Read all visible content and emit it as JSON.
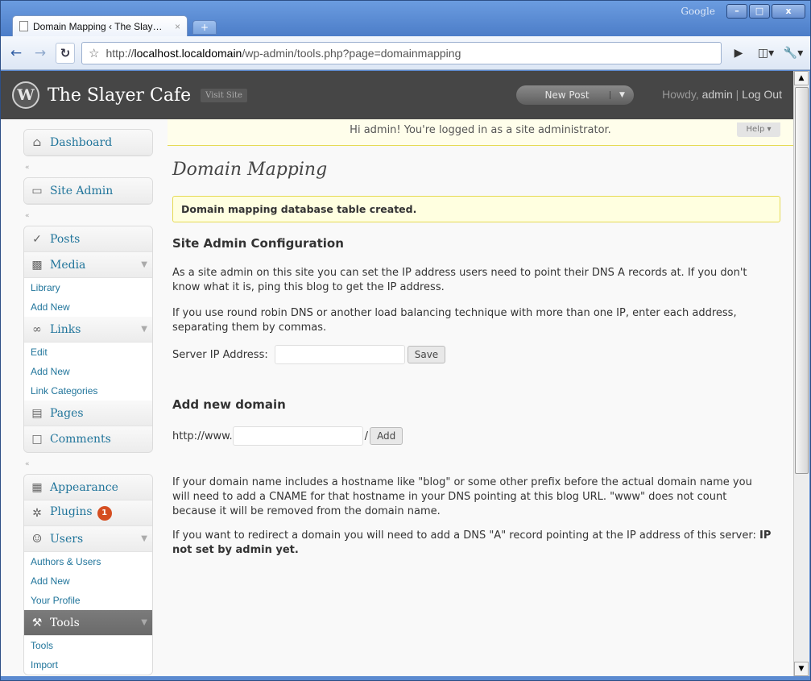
{
  "browser": {
    "google_label": "Google",
    "tab_title": "Domain Mapping ‹ The Slay…",
    "tab_close": "×",
    "new_tab": "+",
    "url_scheme": "http://",
    "url_host": "localhost.localdomain",
    "url_path": "/wp-admin/tools.php?page=domainmapping",
    "win_min": "–",
    "win_max": "□",
    "win_close": "x"
  },
  "header": {
    "site_title": "The Slayer Cafe",
    "visit_site": "Visit Site",
    "new_post": "New Post",
    "howdy_prefix": "Howdy, ",
    "user": "admin",
    "separator": " | ",
    "logout": "Log Out"
  },
  "sidebar": {
    "dashboard": "Dashboard",
    "site_admin": "Site Admin",
    "posts": "Posts",
    "media": "Media",
    "media_items": [
      "Library",
      "Add New"
    ],
    "links": "Links",
    "links_items": [
      "Edit",
      "Add New",
      "Link Categories"
    ],
    "pages": "Pages",
    "comments": "Comments",
    "appearance": "Appearance",
    "plugins": "Plugins",
    "plugins_badge": "1",
    "users": "Users",
    "users_items": [
      "Authors & Users",
      "Add New",
      "Your Profile"
    ],
    "tools": "Tools",
    "tools_items": [
      "Tools",
      "Import"
    ]
  },
  "content": {
    "admin_notice": "Hi admin! You're logged in as a site administrator.",
    "help": "Help ▾",
    "page_title": "Domain Mapping",
    "updated_msg": "Domain mapping database table created.",
    "site_admin_heading": "Site Admin Configuration",
    "para1": "As a site admin on this site you can set the IP address users need to point their DNS A records at. If you don't know what it is, ping this blog to get the IP address.",
    "para2": "If you use round robin DNS or another load balancing technique with more than one IP, enter each address, separating them by commas.",
    "server_ip_label": "Server IP Address:",
    "server_ip_value": "",
    "save_button": "Save",
    "add_domain_heading": "Add new domain",
    "domain_prefix": "http://www.",
    "domain_value": "",
    "domain_suffix": "/",
    "add_button": "Add",
    "para3": "If your domain name includes a hostname like \"blog\" or some other prefix before the actual domain name you will need to add a CNAME for that hostname in your DNS pointing at this blog URL. \"www\" does not count because it will be removed from the domain name.",
    "para4_text": "If you want to redirect a domain you will need to add a DNS \"A\" record pointing at the IP address of this server: ",
    "para4_bold": "IP not set by admin yet."
  }
}
